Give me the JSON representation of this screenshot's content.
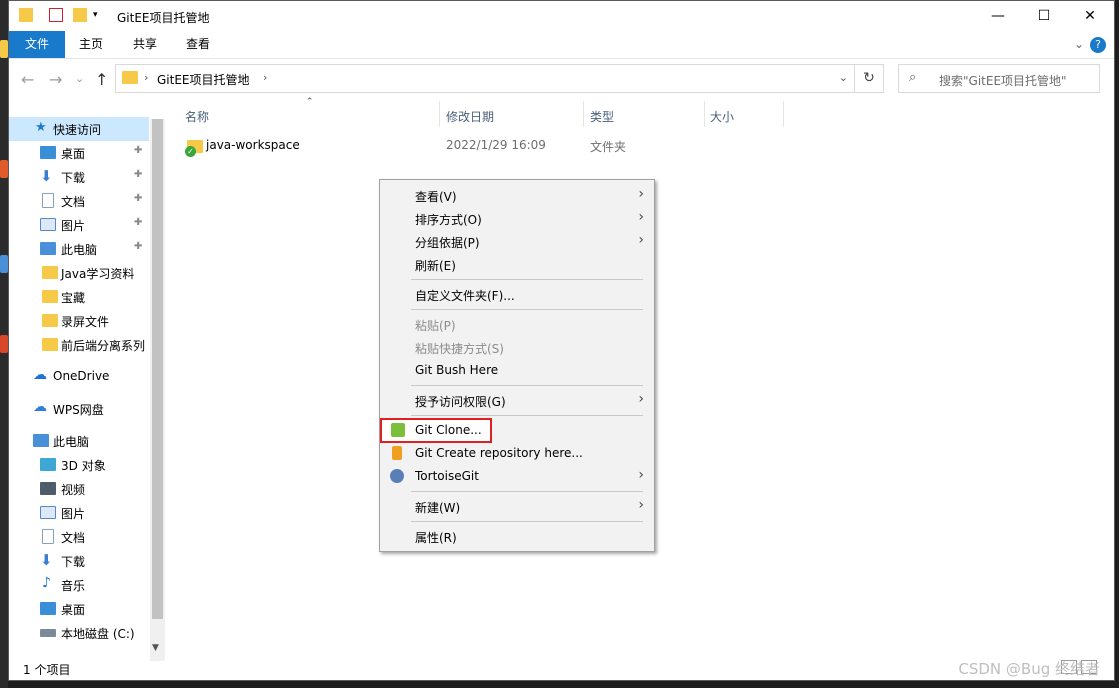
{
  "window": {
    "title": "GitEE项目托管地",
    "controls": {
      "minimize": "—",
      "maximize": "☐",
      "close": "✕"
    }
  },
  "ribbon": {
    "tabs": [
      "文件",
      "主页",
      "共享",
      "查看"
    ],
    "expand_glyph": "⌄",
    "help_glyph": "?"
  },
  "address": {
    "breadcrumb": "GitEE项目托管地",
    "separator": "›",
    "dropdown_glyph": "⌄",
    "refresh_glyph": "↻",
    "search_placeholder": "搜索\"GitEE项目托管地\""
  },
  "nav_buttons": {
    "back": "←",
    "forward": "→",
    "recent": "⌄",
    "up": "↑"
  },
  "sidebar": {
    "items": [
      {
        "label": "快速访问",
        "icon": "star-icon",
        "color": "#1979ca"
      },
      {
        "label": "桌面",
        "icon": "desktop-icon",
        "color": "#3b8fd9",
        "pinned": true
      },
      {
        "label": "下载",
        "icon": "download-icon",
        "color": "#3b7fd4",
        "pinned": true
      },
      {
        "label": "文档",
        "icon": "document-icon",
        "color": "#8aa0b8",
        "pinned": true
      },
      {
        "label": "图片",
        "icon": "picture-icon",
        "color": "#5a8ac6",
        "pinned": true
      },
      {
        "label": "此电脑",
        "icon": "computer-icon",
        "color": "#4a90d9",
        "pinned": true
      },
      {
        "label": "Java学习资料",
        "icon": "folder-icon",
        "color": "#f7c948"
      },
      {
        "label": "宝藏",
        "icon": "folder-icon",
        "color": "#f7c948"
      },
      {
        "label": "录屏文件",
        "icon": "folder-icon",
        "color": "#f7c948"
      },
      {
        "label": "前后端分离系列",
        "icon": "git-folder-icon",
        "color": "#f7c948"
      },
      {
        "label": "OneDrive",
        "icon": "cloud-icon",
        "color": "#1e73d8"
      },
      {
        "label": "WPS网盘",
        "icon": "cloud-icon",
        "color": "#2f7de1"
      },
      {
        "label": "此电脑",
        "icon": "computer-icon",
        "color": "#4a90d9"
      },
      {
        "label": "3D 对象",
        "icon": "cube-icon",
        "color": "#3fa7d6"
      },
      {
        "label": "视频",
        "icon": "film-icon",
        "color": "#4d5b6b"
      },
      {
        "label": "图片",
        "icon": "picture-icon",
        "color": "#5a8ac6"
      },
      {
        "label": "文档",
        "icon": "document-icon",
        "color": "#8aa0b8"
      },
      {
        "label": "下载",
        "icon": "download-icon",
        "color": "#3b7fd4"
      },
      {
        "label": "音乐",
        "icon": "music-icon",
        "color": "#1e73d8"
      },
      {
        "label": "桌面",
        "icon": "desktop-icon",
        "color": "#3b8fd9"
      },
      {
        "label": "本地磁盘 (C:)",
        "icon": "drive-icon",
        "color": "#7a8a99"
      }
    ],
    "pin_glyph": "📌",
    "scroll_down_glyph": "▼"
  },
  "columns": [
    "名称",
    "修改日期",
    "类型",
    "大小"
  ],
  "files": [
    {
      "name": "java-workspace",
      "modified": "2022/1/29 16:09",
      "type": "文件夹",
      "size": ""
    }
  ],
  "status": {
    "count": "1 个项目"
  },
  "context_menu": {
    "items": [
      {
        "label": "查看(V)",
        "submenu": true
      },
      {
        "label": "排序方式(O)",
        "submenu": true
      },
      {
        "label": "分组依据(P)",
        "submenu": true
      },
      {
        "label": "刷新(E)"
      },
      {
        "label": "自定义文件夹(F)..."
      },
      {
        "label": "粘贴(P)",
        "disabled": true
      },
      {
        "label": "粘贴快捷方式(S)",
        "disabled": true
      },
      {
        "label": "Git Bush Here"
      },
      {
        "label": "授予访问权限(G)",
        "submenu": true
      },
      {
        "label": "Git Clone...",
        "highlighted": true
      },
      {
        "label": "Git Create repository here..."
      },
      {
        "label": "TortoiseGit",
        "submenu": true
      },
      {
        "label": "新建(W)",
        "submenu": true
      },
      {
        "label": "属性(R)"
      }
    ],
    "submenu_glyph": "›"
  },
  "watermark": "CSDN @Bug 终结者",
  "accent_color": "#1979ca",
  "highlight_color": "#e02020"
}
